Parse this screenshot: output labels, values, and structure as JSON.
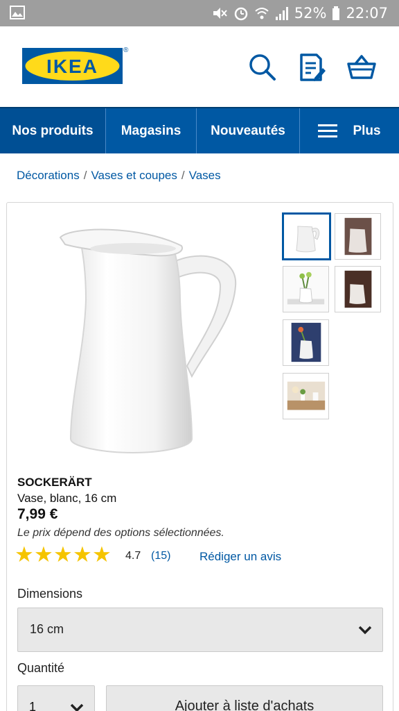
{
  "status_bar": {
    "battery": "52%",
    "time": "22:07",
    "icons": [
      "gallery-icon",
      "mute-icon",
      "alarm-icon",
      "wifi-icon",
      "signal-icon",
      "battery-icon"
    ]
  },
  "header": {
    "logo_text": "IKEA",
    "logo_reg": "®",
    "icons": [
      "search-icon",
      "shopping-list-icon",
      "basket-icon"
    ]
  },
  "nav": {
    "items": [
      {
        "label": "Nos produits"
      },
      {
        "label": "Magasins"
      },
      {
        "label": "Nouveautés"
      },
      {
        "label": "Plus"
      }
    ]
  },
  "breadcrumb": {
    "items": [
      "Décorations",
      "Vases et coupes",
      "Vases"
    ],
    "separator": "/"
  },
  "product": {
    "name": "SOCKERÄRT",
    "description": "Vase, blanc, 16 cm",
    "price": "7,99 €",
    "price_note": "Le prix dépend des options sélectionnées.",
    "rating": "4.7",
    "rating_stars": 4.7,
    "review_count": "(15)",
    "write_review": "Rédiger un avis",
    "dimensions_label": "Dimensions",
    "dimensions_value": "16 cm",
    "quantity_label": "Quantité",
    "quantity_value": "1",
    "add_button": "Ajouter à liste d'achats"
  },
  "colors": {
    "ikea_blue": "#0058a3",
    "ikea_yellow": "#ffda1a",
    "star": "#f5c400"
  }
}
